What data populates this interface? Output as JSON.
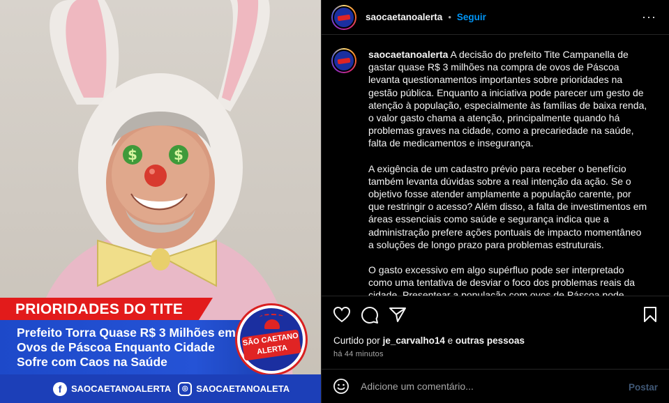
{
  "image": {
    "banner_title": "PRIORIDADES DO TITE",
    "headline": "Prefeito Torra Quase R$ 3 Milhões em Ovos de Páscoa Enquanto Cidade Sofre com Caos na Saúde",
    "badge_text": "SÃO CAETANO ALERTA",
    "facebook_handle": "SAOCAETANOALERTA",
    "instagram_handle": "SAOCAETANOALETA"
  },
  "header": {
    "username": "saocaetanoalerta",
    "separator": "•",
    "follow_label": "Seguir",
    "more_label": "···"
  },
  "caption": {
    "username": "saocaetanoalerta",
    "paragraph_1": "A decisão do prefeito Tite Campanella de gastar quase R$ 3 milhões na compra de ovos de Páscoa levanta questionamentos importantes sobre prioridades na gestão pública. Enquanto a iniciativa pode parecer um gesto de atenção à população, especialmente às famílias de baixa renda, o valor gasto chama a atenção, principalmente quando há problemas graves na cidade, como a precariedade na saúde, falta de medicamentos e insegurança.",
    "paragraph_2": "A exigência de um cadastro prévio para receber o benefício também levanta dúvidas sobre a real intenção da ação. Se o objetivo fosse atender amplamente a população carente, por que restringir o acesso? Além disso, a falta de investimentos em áreas essenciais como saúde e segurança indica que a administração prefere ações pontuais de impacto momentâneo a soluções de longo prazo para problemas estruturais.",
    "paragraph_3": "O gasto excessivo em algo supérfluo pode ser interpretado como uma tentativa de desviar o foco dos problemas reais da cidade. Presentear a população com ovos de Páscoa pode gerar"
  },
  "likes": {
    "prefix": "Curtido por",
    "user": "je_carvalho14",
    "conj": "e",
    "others": "outras pessoas"
  },
  "timestamp": "há 44 minutos",
  "comment_box": {
    "placeholder": "Adicione um comentário...",
    "post_label": "Postar"
  },
  "colors": {
    "accent": "#0095f6",
    "banner_red": "#e21b1b",
    "banner_blue": "#2553d6"
  },
  "icons": [
    "heart-icon",
    "comment-icon",
    "share-icon",
    "bookmark-icon",
    "emoji-icon",
    "facebook-icon",
    "instagram-icon"
  ]
}
